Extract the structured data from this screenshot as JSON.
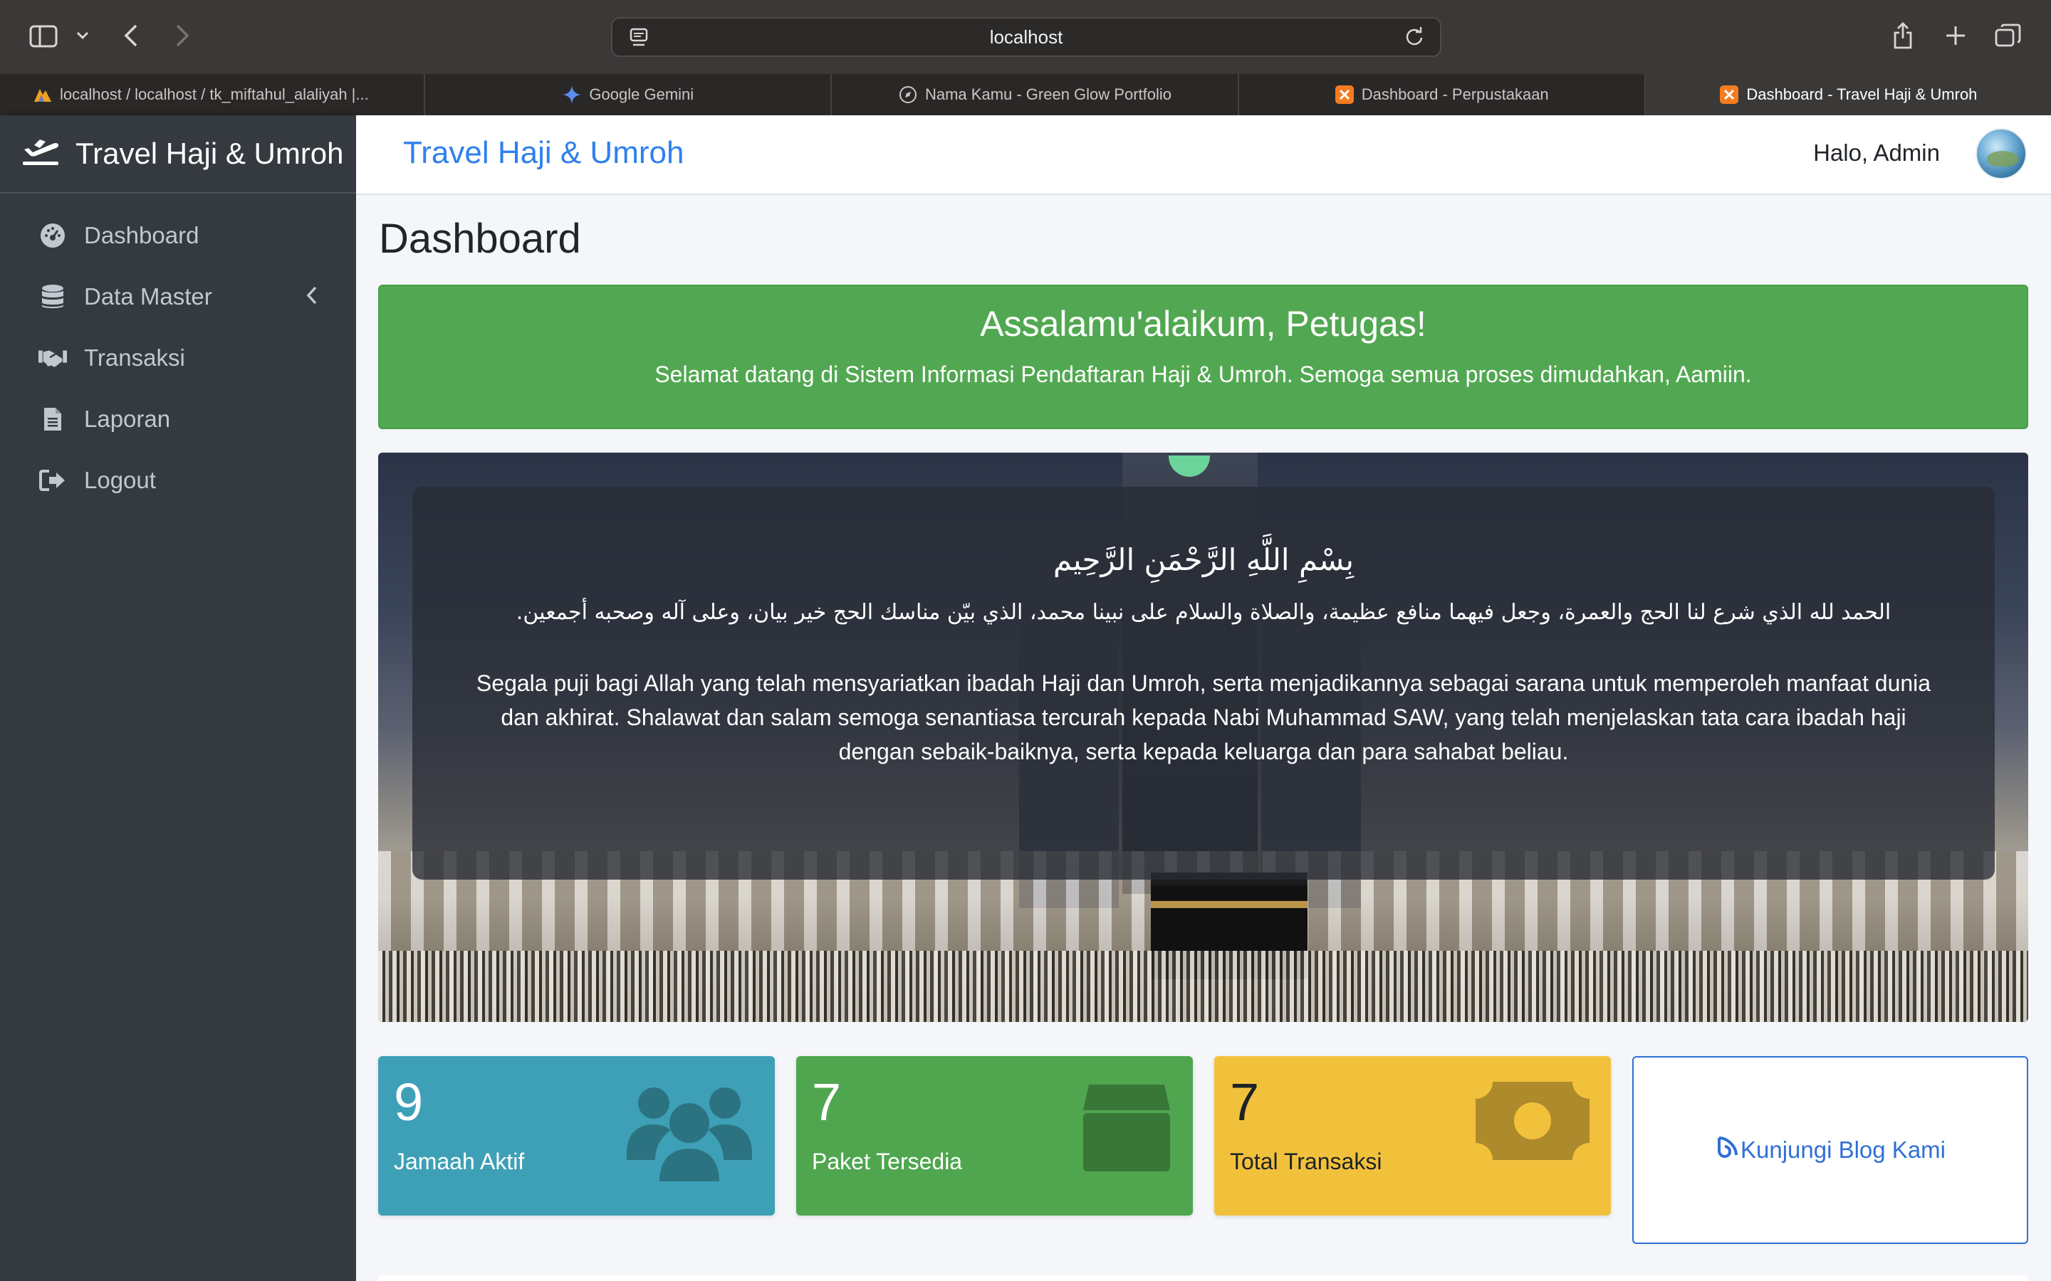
{
  "browser": {
    "url": "localhost",
    "tabs": [
      {
        "label": "localhost / localhost / tk_miftahul_alaliyah |...",
        "favicon": "phpmyadmin-icon"
      },
      {
        "label": "Google Gemini",
        "favicon": "gemini-icon"
      },
      {
        "label": "Nama Kamu - Green Glow Portfolio",
        "favicon": "compass-icon"
      },
      {
        "label": "Dashboard - Perpustakaan",
        "favicon": "xampp-icon"
      },
      {
        "label": "Dashboard - Travel Haji & Umroh",
        "favicon": "xampp-icon",
        "active": true
      }
    ]
  },
  "sidebar": {
    "brand": "Travel Haji & Umroh",
    "brand_icon": "plane-departure-icon",
    "items": [
      {
        "label": "Dashboard",
        "icon": "tachometer-icon"
      },
      {
        "label": "Data Master",
        "icon": "database-icon",
        "has_chevron": true
      },
      {
        "label": "Transaksi",
        "icon": "handshake-icon"
      },
      {
        "label": "Laporan",
        "icon": "file-icon"
      },
      {
        "label": "Logout",
        "icon": "sign-out-icon"
      }
    ]
  },
  "topnav": {
    "title": "Travel Haji & Umroh",
    "greeting": "Halo, Admin"
  },
  "page": {
    "title": "Dashboard"
  },
  "welcome": {
    "heading": "Assalamu'alaikum, Petugas!",
    "text": "Selamat datang di Sistem Informasi Pendaftaran Haji & Umroh. Semoga semua proses dimudahkan, Aamiin."
  },
  "prayer": {
    "bismillah": "بِسْمِ اللَّهِ الرَّحْمَنِ الرَّحِيم",
    "arabic": "الحمد لله الذي شرع لنا الحج والعمرة، وجعل فيهما منافع عظيمة، والصلاة والسلام على نبينا محمد، الذي بيّن مناسك الحج خير بيان، وعلى آله وصحبه أجمعين.",
    "indonesian": "Segala puji bagi Allah yang telah mensyariatkan ibadah Haji dan Umroh, serta menjadikannya sebagai sarana untuk memperoleh manfaat dunia dan akhirat. Shalawat dan salam semoga senantiasa tercurah kepada Nabi Muhammad SAW, yang telah menjelaskan tata cara ibadah haji dengan sebaik-baiknya, serta kepada keluarga dan para sahabat beliau."
  },
  "stats": [
    {
      "value": "9",
      "label": "Jamaah Aktif",
      "icon": "users-icon",
      "color": "#3ea0b6"
    },
    {
      "value": "7",
      "label": "Paket Tersedia",
      "icon": "box-icon",
      "color": "#4fa64f"
    },
    {
      "value": "7",
      "label": "Total Transaksi",
      "icon": "money-bill-icon",
      "color": "#f2c13c"
    }
  ],
  "blog_link": {
    "label": "Kunjungi Blog Kami",
    "icon": "blog-icon"
  }
}
